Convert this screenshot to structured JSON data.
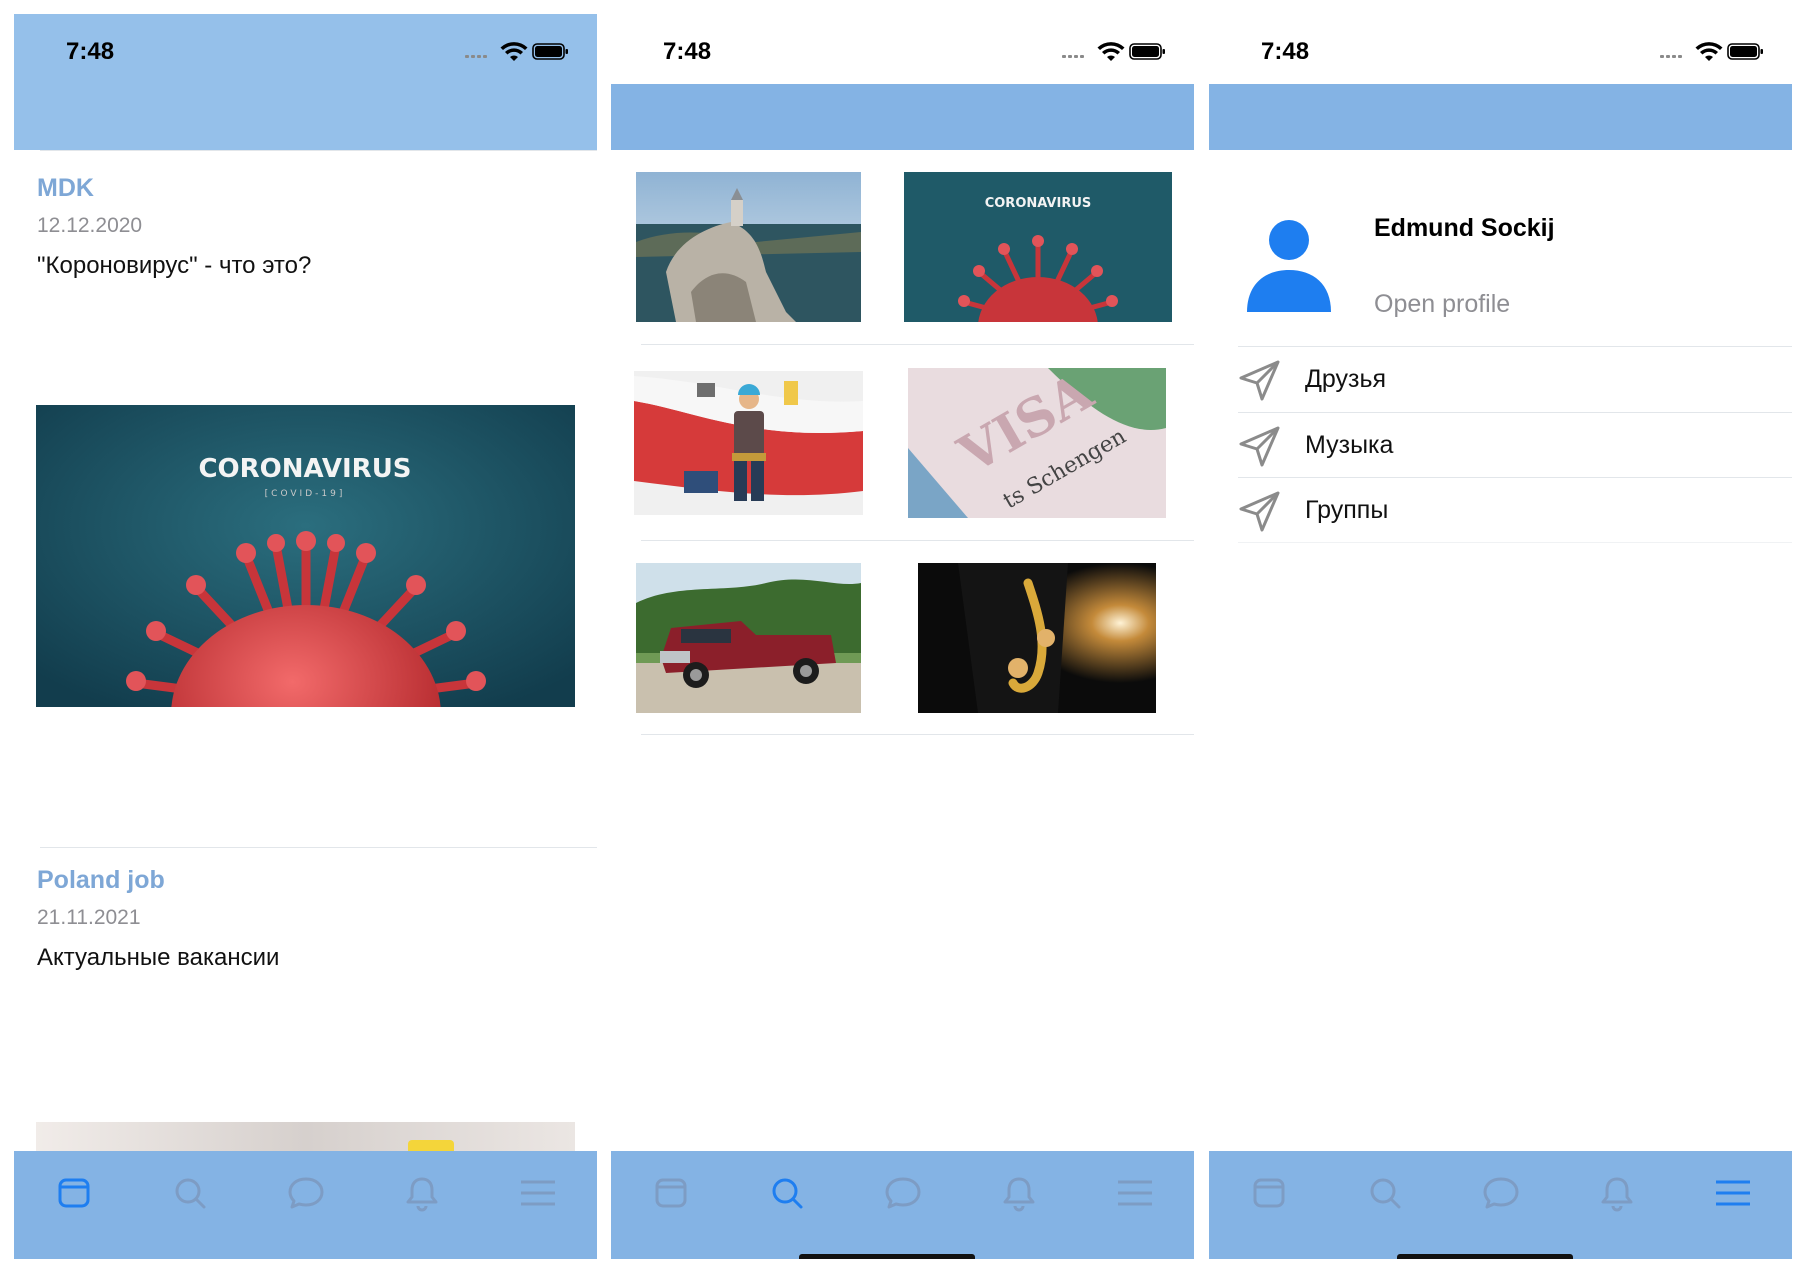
{
  "colors": {
    "status_bar_feed": "#95c0ea",
    "bar_blue": "#84b3e4",
    "accent": "#1e7ef0",
    "tab_inactive": "#7d9cc4",
    "post_title": "#7ea7d6"
  },
  "status_bar": {
    "time": "7:48"
  },
  "tabs": [
    {
      "icon": "feed-icon"
    },
    {
      "icon": "search-icon"
    },
    {
      "icon": "chat-bubble-icon"
    },
    {
      "icon": "bell-icon"
    },
    {
      "icon": "menu-icon"
    }
  ],
  "screens": [
    {
      "name": "feed",
      "active_tab": 0
    },
    {
      "name": "search",
      "active_tab": 1
    },
    {
      "name": "menu",
      "active_tab": 4
    }
  ],
  "feed": {
    "posts": [
      {
        "title": "MDK",
        "date": "12.12.2020",
        "text": "\"Короновирус\" - что это?",
        "image": "coronavirus-image"
      },
      {
        "title": "Poland job",
        "date": "21.11.2021",
        "text": "Актуальные вакансии",
        "image": "poland-job-image"
      }
    ],
    "banner_text": {
      "headline": "CORONAVIRUS",
      "sub": "[COVID-19]"
    }
  },
  "gallery": {
    "thumbnails": [
      "castle-on-cliff",
      "coronavirus",
      "handyman-poland",
      "schengen-visa",
      "red-pickup-truck",
      "saxophone-player"
    ],
    "schengen_text": "VISA",
    "schengen_sub": "ts Schengen"
  },
  "menu": {
    "profile_name": "Edmund Sockij",
    "profile_link": "Open profile",
    "items": [
      {
        "label": "Друзья",
        "icon": "paper-plane-icon"
      },
      {
        "label": "Музыка",
        "icon": "paper-plane-icon"
      },
      {
        "label": "Группы",
        "icon": "paper-plane-icon"
      }
    ]
  }
}
